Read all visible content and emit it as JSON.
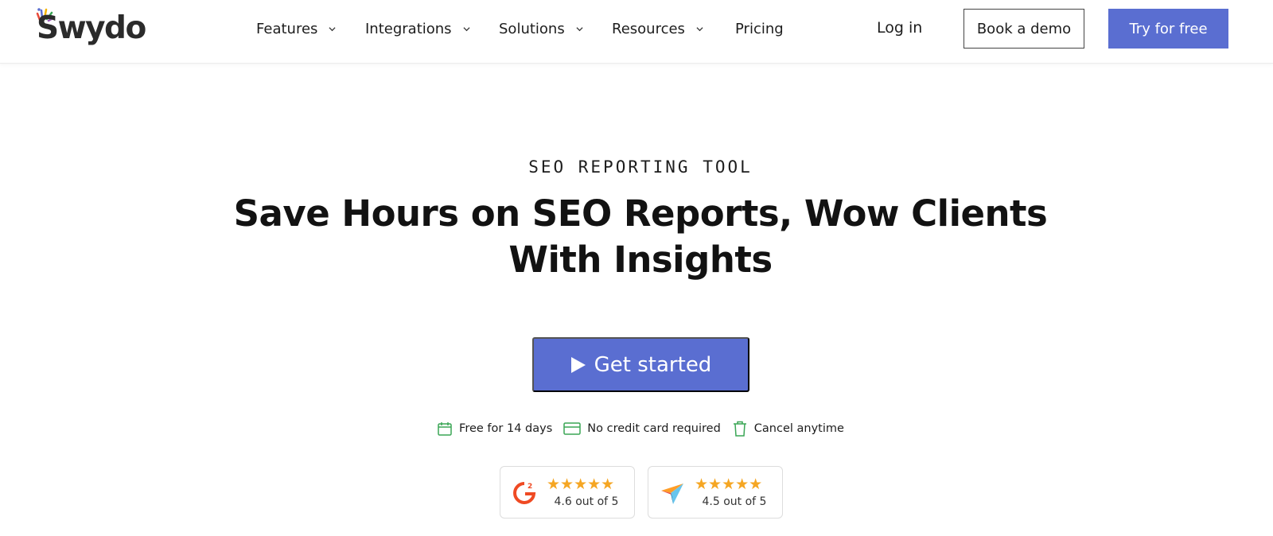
{
  "brand": {
    "name": "Swydo",
    "colors": {
      "primary": "#5a6ed1",
      "text": "#121212",
      "perk_icon": "#3aa655",
      "star": "#f5a623"
    }
  },
  "nav": {
    "items": [
      {
        "label": "Features",
        "has_dropdown": true
      },
      {
        "label": "Integrations",
        "has_dropdown": true
      },
      {
        "label": "Solutions",
        "has_dropdown": true
      },
      {
        "label": "Resources",
        "has_dropdown": true
      },
      {
        "label": "Pricing",
        "has_dropdown": false
      }
    ],
    "login": "Log in",
    "book_demo": "Book a demo",
    "try_free": "Try for free"
  },
  "hero": {
    "eyebrow": "SEO REPORTING TOOL",
    "headline": "Save Hours on SEO Reports, Wow Clients With Insights",
    "cta_label": "Get started",
    "perks": [
      {
        "icon": "calendar-icon",
        "label": "Free for 14 days"
      },
      {
        "icon": "credit-card-icon",
        "label": "No credit card required"
      },
      {
        "icon": "trash-icon",
        "label": "Cancel anytime"
      }
    ]
  },
  "ratings": [
    {
      "source_icon": "g2-logo-icon",
      "stars": "★★★★★",
      "score": "4.6 out of 5",
      "star_count": 5
    },
    {
      "source_icon": "capterra-logo-icon",
      "stars": "★★★★★",
      "score": "4.5 out of 5",
      "star_count": 5
    }
  ]
}
